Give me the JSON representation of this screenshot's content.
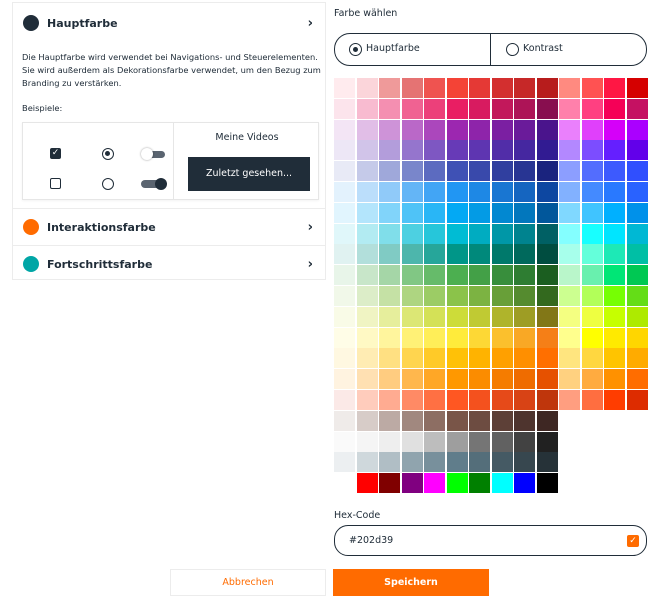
{
  "accordion": {
    "items": [
      {
        "title": "Hauptfarbe",
        "color": "#202d39",
        "expanded": true
      },
      {
        "title": "Interaktionsfarbe",
        "color": "#ff6b00",
        "expanded": false
      },
      {
        "title": "Fortschrittsfarbe",
        "color": "#00a6a6",
        "expanded": false
      }
    ],
    "description": "Die Hauptfarbe wird verwendet bei Navigations- und Steuerelementen. Sie wird außerdem als Dekorationsfarbe verwendet, um den Bezug zum Branding zu verstärken.",
    "examples_label": "Beispiele:",
    "preview": {
      "videos_label": "Meine Videos",
      "recent_button": "Zuletzt gesehen..."
    }
  },
  "picker": {
    "label": "Farbe wählen",
    "options": [
      {
        "label": "Hauptfarbe",
        "selected": true
      },
      {
        "label": "Kontrast",
        "selected": false
      }
    ],
    "palette_rows": [
      [
        "#ffebee",
        "#fbd5da",
        "#ef9a9a",
        "#e57373",
        "#ef5350",
        "#f44336",
        "#e53935",
        "#d32f2f",
        "#c62828",
        "#b71c1c",
        "#ff8a80",
        "#ff5252",
        "#ff1744",
        "#d50000"
      ],
      [
        "#fce4ec",
        "#f8bbd0",
        "#f48fb1",
        "#f06292",
        "#ec407a",
        "#e91e63",
        "#d81b60",
        "#c2185b",
        "#ad1457",
        "#880e4f",
        "#ff80ab",
        "#ff4081",
        "#f50057",
        "#c51162"
      ],
      [
        "#f3e5f5",
        "#e1bee7",
        "#ce93d8",
        "#ba68c8",
        "#ab47bc",
        "#9c27b0",
        "#8e24aa",
        "#7b1fa2",
        "#6a1b9a",
        "#4a148c",
        "#ea80fc",
        "#e040fb",
        "#d500f9",
        "#aa00ff"
      ],
      [
        "#ede7f6",
        "#d1c4e9",
        "#b39ddb",
        "#9575cd",
        "#7e57c2",
        "#673ab7",
        "#5e35b1",
        "#512da8",
        "#4527a0",
        "#311b92",
        "#b388ff",
        "#7c4dff",
        "#651fff",
        "#6200ea"
      ],
      [
        "#e8eaf6",
        "#c5cae9",
        "#9fa8da",
        "#7986cb",
        "#5c6bc0",
        "#3f51b5",
        "#3949ab",
        "#303f9f",
        "#283593",
        "#1a237e",
        "#8c9eff",
        "#536dfe",
        "#3d5afe",
        "#304ffe"
      ],
      [
        "#e3f2fd",
        "#bbdefb",
        "#90caf9",
        "#64b5f6",
        "#42a5f5",
        "#2196f3",
        "#1e88e5",
        "#1976d2",
        "#1565c0",
        "#0d47a1",
        "#82b1ff",
        "#448aff",
        "#2979ff",
        "#2962ff"
      ],
      [
        "#e1f5fe",
        "#b3e5fc",
        "#81d4fa",
        "#4fc3f7",
        "#29b6f6",
        "#03a9f4",
        "#039be5",
        "#0288d1",
        "#0277bd",
        "#01579b",
        "#80d8ff",
        "#40c4ff",
        "#00b0ff",
        "#0091ea"
      ],
      [
        "#e0f7fa",
        "#b2ebf2",
        "#80deea",
        "#4dd0e1",
        "#26c6da",
        "#00bcd4",
        "#00acc1",
        "#0097a7",
        "#00838f",
        "#006064",
        "#84ffff",
        "#18ffff",
        "#00e5ff",
        "#00b8d4"
      ],
      [
        "#e0f2f1",
        "#b2dfdb",
        "#80cbc4",
        "#4db6ac",
        "#26a69a",
        "#009688",
        "#00897b",
        "#00796b",
        "#00695c",
        "#004d40",
        "#a7ffeb",
        "#64ffda",
        "#1de9b6",
        "#00bfa5"
      ],
      [
        "#e8f5e9",
        "#c8e6c9",
        "#a5d6a7",
        "#81c784",
        "#66bb6a",
        "#4caf50",
        "#43a047",
        "#388e3c",
        "#2e7d32",
        "#1b5e20",
        "#b9f6ca",
        "#69f0ae",
        "#00e676",
        "#00c853"
      ],
      [
        "#f1f8e9",
        "#dcedc8",
        "#c5e1a5",
        "#aed581",
        "#9ccc65",
        "#8bc34a",
        "#7cb342",
        "#689f38",
        "#558b2f",
        "#33691e",
        "#ccff90",
        "#b2ff59",
        "#76ff03",
        "#64dd17"
      ],
      [
        "#f9fbe7",
        "#f0f4c3",
        "#e6ee9c",
        "#dce775",
        "#d4e157",
        "#cddc39",
        "#c0ca33",
        "#afb42b",
        "#9e9d24",
        "#827717",
        "#f4ff81",
        "#eeff41",
        "#c6ff00",
        "#aeea00"
      ],
      [
        "#fffde7",
        "#fff9c4",
        "#fff59d",
        "#fff176",
        "#ffee58",
        "#ffeb3b",
        "#fdd835",
        "#fbc02d",
        "#f9a825",
        "#f57f17",
        "#ffff8d",
        "#ffff00",
        "#ffea00",
        "#ffd600"
      ],
      [
        "#fff8e1",
        "#ffecb3",
        "#ffe082",
        "#ffd54f",
        "#ffca28",
        "#ffc107",
        "#ffb300",
        "#ffa000",
        "#ff8f00",
        "#ff6f00",
        "#ffe57f",
        "#ffd740",
        "#ffc400",
        "#ffab00"
      ],
      [
        "#fff3e0",
        "#ffe0b2",
        "#ffcc80",
        "#ffb74d",
        "#ffa726",
        "#ff9800",
        "#fb8c00",
        "#f57c00",
        "#ef6c00",
        "#e65100",
        "#ffd180",
        "#ffab40",
        "#ff9100",
        "#ff6d00"
      ],
      [
        "#fbe9e7",
        "#ffccbc",
        "#ffab91",
        "#ff8a65",
        "#ff7043",
        "#ff5722",
        "#f4511e",
        "#e64a19",
        "#d84315",
        "#bf360c",
        "#ff9e80",
        "#ff6e40",
        "#ff3d00",
        "#dd2c00"
      ],
      [
        "#efebe9",
        "#d7ccc8",
        "#bcaaa4",
        "#a1887f",
        "#8d6e63",
        "#795548",
        "#6d4c41",
        "#5d4037",
        "#4e342e",
        "#3e2723"
      ],
      [
        "#fafafa",
        "#f5f5f5",
        "#eeeeee",
        "#e0e0e0",
        "#bdbdbd",
        "#9e9e9e",
        "#757575",
        "#616161",
        "#424242",
        "#212121"
      ],
      [
        "#eceff1",
        "#cfd8dc",
        "#b0bec5",
        "#90a4ae",
        "#78909c",
        "#607d8b",
        "#546e7a",
        "#455a64",
        "#37474f",
        "#263238"
      ],
      [
        "#ffffff",
        "#ff0000",
        "#800000",
        "#800080",
        "#ff00ff",
        "#00ff00",
        "#008000",
        "#00ffff",
        "#0000ff",
        "#000000"
      ]
    ],
    "hex_label": "Hex-Code",
    "hex_value": "#202d39"
  },
  "actions": {
    "cancel": "Abbrechen",
    "save": "Speichern"
  },
  "colors": {
    "primary": "#202d39",
    "accent": "#ff6b00",
    "teal": "#00a6a6"
  }
}
